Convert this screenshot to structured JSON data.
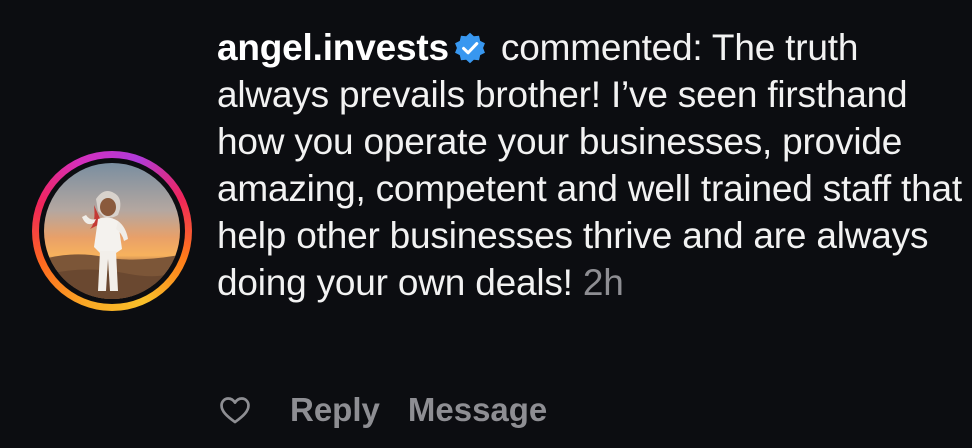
{
  "comment": {
    "username": "angel.invests",
    "verified": true,
    "text": " commented: The truth always prevails brother! I’ve seen firsthand how you operate your businesses, provide amazing, competent and well trained staff that help other businesses thrive and are always doing your own deals! ",
    "timestamp": "2h"
  },
  "actions": {
    "like_icon": "heart-outline-icon",
    "reply_label": "Reply",
    "message_label": "Message"
  },
  "colors": {
    "background": "#0c0d11",
    "text": "#f2f2f2",
    "muted": "#8e8e93",
    "verified_badge": "#3897f0"
  }
}
